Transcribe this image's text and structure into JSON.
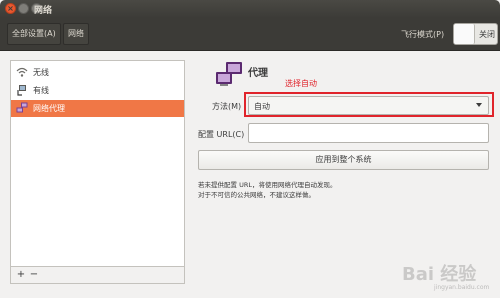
{
  "window": {
    "title": "网络"
  },
  "toolbar": {
    "all_settings": "全部设置(A)",
    "breadcrumb": "网络",
    "airplane_label": "飞行模式(P)",
    "airplane_state": "关闭"
  },
  "sidebar": {
    "items": [
      {
        "label": "无线",
        "icon": "wifi-icon"
      },
      {
        "label": "有线",
        "icon": "wired-network-icon"
      },
      {
        "label": "网络代理",
        "icon": "network-proxy-icon",
        "selected": true
      }
    ],
    "add": "+",
    "remove": "−"
  },
  "proxy": {
    "title": "代理",
    "annotation": "选择自动",
    "method_label": "方法(M)",
    "method_value": "自动",
    "url_label": "配置 URL(C)",
    "url_value": "",
    "apply_button": "应用到整个系统",
    "info_line1": "若未提供配置 URL，将使用网络代理自动发现。",
    "info_line2": "对于不可信的公共网络，不建议这样做。"
  },
  "colors": {
    "accent": "#f07746",
    "annotation": "#e0242b",
    "titlebar": "#3c3b37"
  },
  "watermark": {
    "text": "Bai 经验",
    "sub": "jingyan.baidu.com"
  }
}
